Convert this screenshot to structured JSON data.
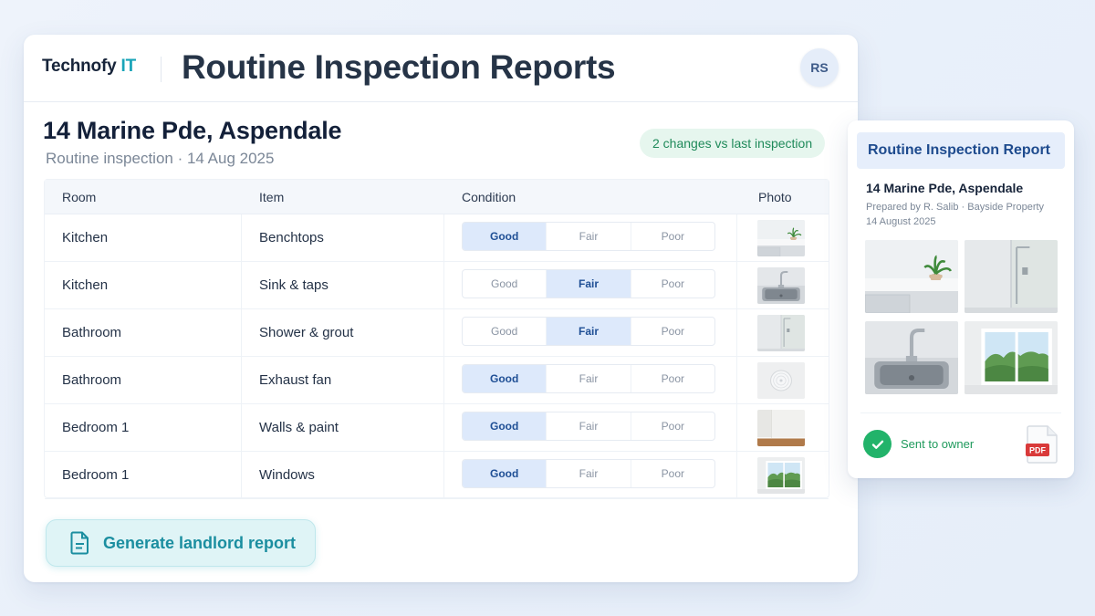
{
  "brand": {
    "name": "Technofy",
    "accent": "IT"
  },
  "page_title": "Routine Inspection Reports",
  "avatar_initials": "RS",
  "property": {
    "address": "14 Marine Pde, Aspendale",
    "subtitle": "Routine inspection · 14 Aug 2025",
    "changes_badge": "2 changes vs last inspection"
  },
  "table": {
    "headers": {
      "room": "Room",
      "item": "Item",
      "condition": "Condition",
      "photo": "Photo"
    },
    "condition_options": [
      "Good",
      "Fair",
      "Poor"
    ],
    "rows": [
      {
        "room": "Kitchen",
        "item": "Benchtops",
        "condition": "Good",
        "photo": "benchtop-photo"
      },
      {
        "room": "Kitchen",
        "item": "Sink & taps",
        "condition": "Fair",
        "photo": "sink-photo"
      },
      {
        "room": "Bathroom",
        "item": "Shower & grout",
        "condition": "Fair",
        "photo": "shower-photo"
      },
      {
        "room": "Bathroom",
        "item": "Exhaust fan",
        "condition": "Good",
        "photo": "exhaust-fan-photo"
      },
      {
        "room": "Bedroom 1",
        "item": "Walls & paint",
        "condition": "Good",
        "photo": "walls-photo"
      },
      {
        "room": "Bedroom 1",
        "item": "Windows",
        "condition": "Good",
        "photo": "window-photo"
      }
    ]
  },
  "cta": {
    "label": "Generate landlord report",
    "icon": "document-icon"
  },
  "report_card": {
    "title": "Routine Inspection Report",
    "address": "14 Marine Pde, Aspendale",
    "prepared_by": "Prepared by R. Salib · Bayside Property",
    "date": "14 August 2025",
    "photos": [
      "benchtop-photo",
      "shower-photo",
      "sink-photo",
      "window-photo"
    ],
    "status": "Sent to owner",
    "status_icon": "check-icon",
    "file_badge": "PDF"
  },
  "colors": {
    "accent": "#19a4b8",
    "selected_condition": "#dde9fb",
    "success": "#22b36a",
    "pdf_red": "#d93a3a"
  }
}
